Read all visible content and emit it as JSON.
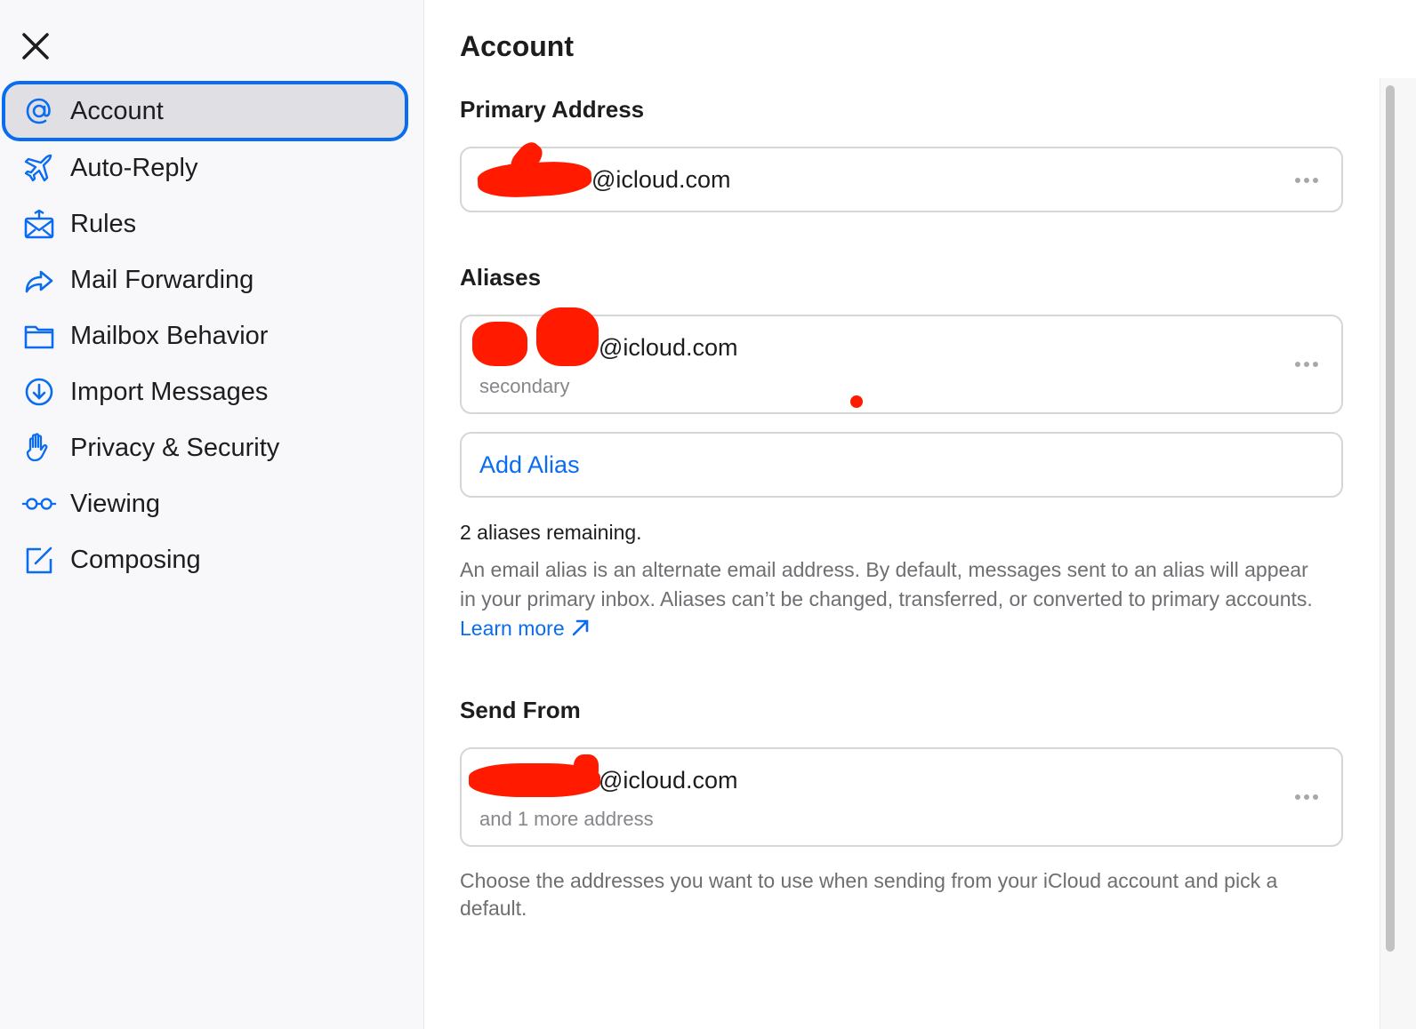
{
  "sidebar": {
    "close_icon": "close-icon",
    "items": [
      {
        "label": "Account",
        "icon": "at-icon",
        "active": true
      },
      {
        "label": "Auto-Reply",
        "icon": "airplane-icon"
      },
      {
        "label": "Rules",
        "icon": "envelope-rules-icon"
      },
      {
        "label": "Mail Forwarding",
        "icon": "forward-arrow-icon"
      },
      {
        "label": "Mailbox Behavior",
        "icon": "folder-icon"
      },
      {
        "label": "Import Messages",
        "icon": "download-circle-icon"
      },
      {
        "label": "Privacy & Security",
        "icon": "hand-icon"
      },
      {
        "label": "Viewing",
        "icon": "glasses-icon"
      },
      {
        "label": "Composing",
        "icon": "compose-icon"
      }
    ]
  },
  "main": {
    "title": "Account",
    "primary": {
      "heading": "Primary Address",
      "address_suffix": "@icloud.com"
    },
    "aliases": {
      "heading": "Aliases",
      "alias_suffix": "@icloud.com",
      "alias_label": "secondary",
      "add_alias": "Add Alias",
      "remaining": "2 aliases remaining.",
      "description": "An email alias is an alternate email address. By default, messages sent to an alias will appear in your primary inbox. Aliases can’t be changed, transferred, or converted to primary accounts.",
      "learn_more": "Learn more"
    },
    "send_from": {
      "heading": "Send From",
      "address_suffix": "@icloud.com",
      "more_text": "and 1 more address",
      "description": "Choose the addresses you want to use when sending from your iCloud account and pick a default."
    }
  },
  "colors": {
    "accent": "#0a6cf0",
    "redaction": "#ff1a00"
  }
}
